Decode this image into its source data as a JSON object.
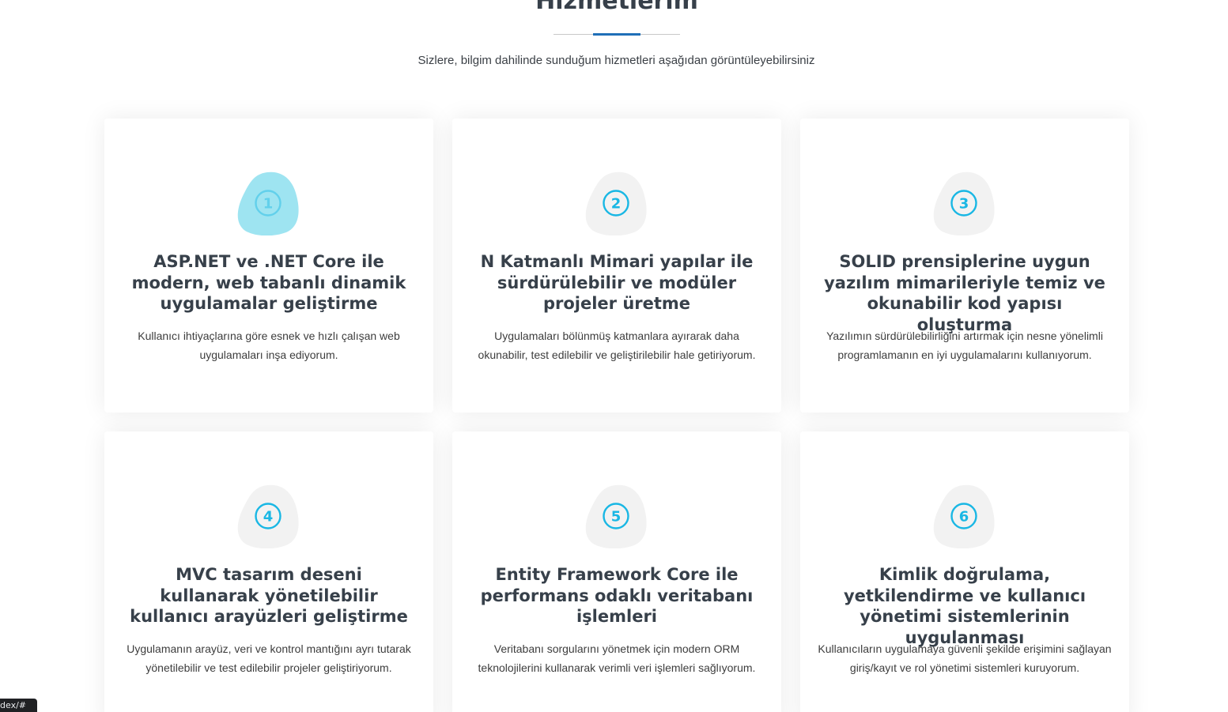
{
  "section": {
    "title": "Hizmetlerim",
    "subtitle": "Sizlere, bilgim dahilinde sunduğum hizmetleri aşağıdan görüntüleyebilirsiniz"
  },
  "colors": {
    "accent": "#1f6fb8",
    "icon_stroke": "#19b7e4",
    "blob_active": "#9ee4f1",
    "blob_default": "#f2f2f2",
    "heading": "#37404a"
  },
  "services": [
    {
      "number": "1",
      "icon": "circled-number-1-icon",
      "active": true,
      "title": "ASP.NET ve .NET Core ile modern, web tabanlı dinamik uygulamalar geliştirme",
      "description": "Kullanıcı ihtiyaçlarına göre esnek ve hızlı çalışan web uygulamaları inşa ediyorum."
    },
    {
      "number": "2",
      "icon": "circled-number-2-icon",
      "active": false,
      "title": "N Katmanlı Mimari yapılar ile sürdürülebilir ve modüler projeler üretme",
      "description": "Uygulamaları bölünmüş katmanlara ayırarak daha okunabilir, test edilebilir ve geliştirilebilir hale getiriyorum."
    },
    {
      "number": "3",
      "icon": "circled-number-3-icon",
      "active": false,
      "title": "SOLID prensiplerine uygun yazılım mimarileriyle temiz ve okunabilir kod yapısı oluşturma",
      "description": "Yazılımın sürdürülebilirliğini artırmak için nesne yönelimli programlamanın en iyi uygulamalarını kullanıyorum."
    },
    {
      "number": "4",
      "icon": "circled-number-4-icon",
      "active": false,
      "title": "MVC tasarım deseni kullanarak yönetilebilir kullanıcı arayüzleri geliştirme",
      "description": "Uygulamanın arayüz, veri ve kontrol mantığını ayrı tutarak yönetilebilir ve test edilebilir projeler geliştiriyorum."
    },
    {
      "number": "5",
      "icon": "circled-number-5-icon",
      "active": false,
      "title": "Entity Framework Core ile performans odaklı veritabanı işlemleri",
      "description": "Veritabanı sorgularını yönetmek için modern ORM teknolojilerini kullanarak verimli veri işlemleri sağlıyorum."
    },
    {
      "number": "6",
      "icon": "circled-number-6-icon",
      "active": false,
      "title": "Kimlik doğrulama, yetkilendirme ve kullanıcı yönetimi sistemlerinin uygulanması",
      "description": "Kullanıcıların uygulamaya güvenli şekilde erişimini sağlayan giriş/kayıt ve rol yönetimi sistemleri kuruyorum."
    }
  ],
  "status_bar": {
    "url": "index/#"
  }
}
